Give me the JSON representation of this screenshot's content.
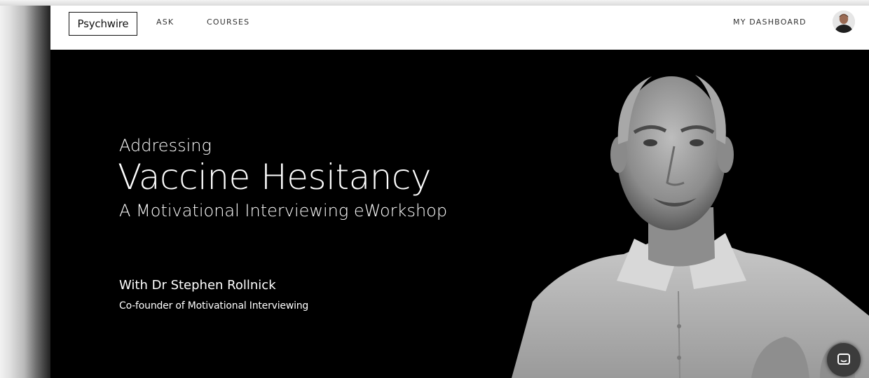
{
  "brand": {
    "logo_text": "Psychwire"
  },
  "nav": {
    "ask_label": "ASK",
    "courses_label": "COURSES",
    "dashboard_label": "MY DASHBOARD"
  },
  "hero": {
    "kicker": "Addressing",
    "title": "Vaccine Hesitancy",
    "subtitle": "A Motivational Interviewing eWorkshop",
    "presenter": "With Dr Stephen Rollnick",
    "presenter_role": "Co-founder of Motivational Interviewing"
  },
  "icons": {
    "avatar": "user-avatar",
    "chat": "chat-icon"
  },
  "colors": {
    "nav_background": "#ffffff",
    "hero_background": "#000000",
    "hero_text": "#ffffff",
    "chat_button": "#3c3c3c"
  }
}
